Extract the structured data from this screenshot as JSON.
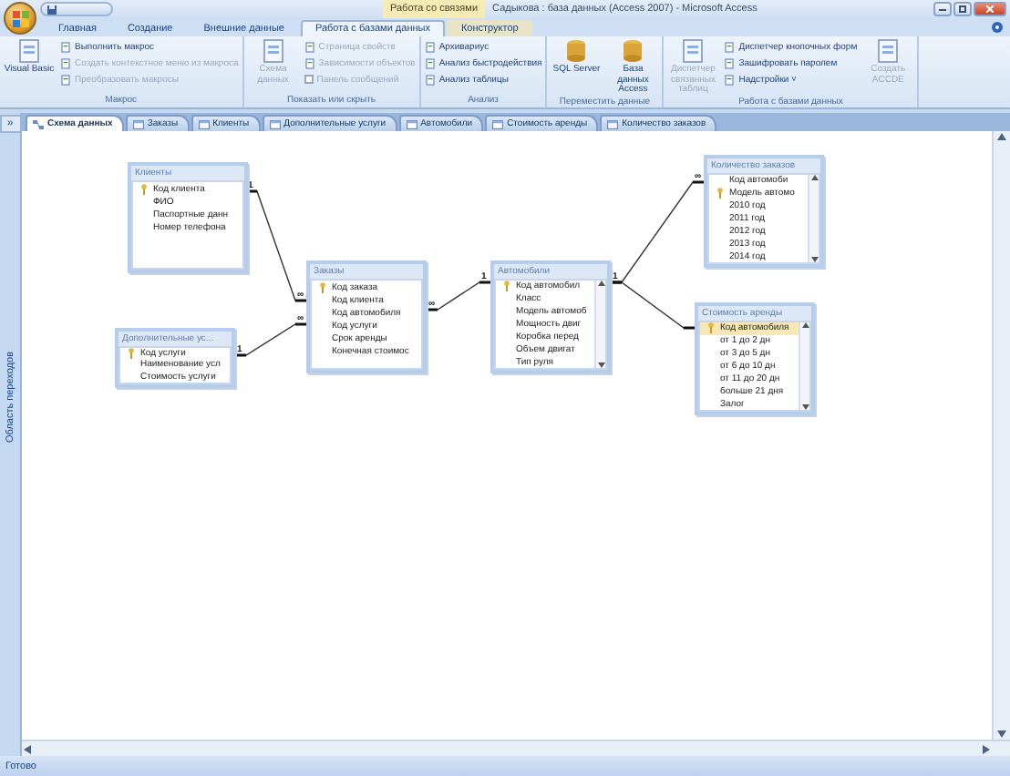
{
  "window": {
    "context_tab": "Работа со связями",
    "title": "Садыкова : база данных (Access 2007) - Microsoft Access"
  },
  "ribbon_tabs": [
    {
      "label": "Главная",
      "selected": false,
      "context": false
    },
    {
      "label": "Создание",
      "selected": false,
      "context": false
    },
    {
      "label": "Внешние данные",
      "selected": false,
      "context": false
    },
    {
      "label": "Работа с базами данных",
      "selected": true,
      "context": false
    },
    {
      "label": "Конструктор",
      "selected": false,
      "context": true
    }
  ],
  "ribbon_groups": [
    {
      "title": "Макрос",
      "items": [
        {
          "kind": "large",
          "label": "Visual Basic",
          "disabled": false
        },
        {
          "kind": "stack",
          "items": [
            {
              "label": "Выполнить макрос",
              "disabled": false
            },
            {
              "label": "Создать контекстное меню из макроса",
              "disabled": true
            },
            {
              "label": "Преобразовать макросы",
              "disabled": true
            }
          ]
        }
      ]
    },
    {
      "title": "Показать или скрыть",
      "items": [
        {
          "kind": "large",
          "label": "Схема данных",
          "disabled": true
        },
        {
          "kind": "stack",
          "items": [
            {
              "label": "Страница свойств",
              "disabled": true
            },
            {
              "label": "Зависимости объектов",
              "disabled": true
            },
            {
              "label": "Панель сообщений",
              "disabled": true,
              "checkbox": true,
              "checked": false
            }
          ]
        }
      ]
    },
    {
      "title": "Анализ",
      "items": [
        {
          "kind": "stack",
          "items": [
            {
              "label": "Архивариус",
              "disabled": false
            },
            {
              "label": "Анализ быстродействия",
              "disabled": false
            },
            {
              "label": "Анализ таблицы",
              "disabled": false
            }
          ]
        }
      ]
    },
    {
      "title": "Переместить данные",
      "items": [
        {
          "kind": "database",
          "label": "SQL Server",
          "disabled": false
        },
        {
          "kind": "database",
          "label": "База данных Access",
          "disabled": false
        }
      ]
    },
    {
      "title": "Работа с базами данных",
      "items": [
        {
          "kind": "large",
          "label": "Диспетчер связанных таблиц",
          "disabled": true
        },
        {
          "kind": "stack",
          "items": [
            {
              "label": "Диспетчер кнопочных форм",
              "disabled": false
            },
            {
              "label": "Зашифровать паролем",
              "disabled": false
            },
            {
              "label": "Надстройки ˅",
              "disabled": false
            }
          ]
        },
        {
          "kind": "large",
          "label": "Создать ACCDE",
          "disabled": true
        }
      ]
    }
  ],
  "nav_pane": {
    "toggle": "»",
    "label": "Область переходов"
  },
  "doc_tabs": [
    {
      "label": "Схема данных",
      "selected": true,
      "kind": "diagram"
    },
    {
      "label": "Заказы",
      "selected": false,
      "kind": "table"
    },
    {
      "label": "Клиенты",
      "selected": false,
      "kind": "table"
    },
    {
      "label": "Дополнительные услуги",
      "selected": false,
      "kind": "table"
    },
    {
      "label": "Автомобили",
      "selected": false,
      "kind": "table"
    },
    {
      "label": "Стоимость аренды",
      "selected": false,
      "kind": "table"
    },
    {
      "label": "Количество заказов",
      "selected": false,
      "kind": "table"
    }
  ],
  "tables": [
    {
      "title": "Клиенты",
      "scrollable": false,
      "fields": [
        {
          "name": "Код клиента",
          "key": true,
          "selected": false
        },
        {
          "name": "ФИО",
          "key": false,
          "selected": false
        },
        {
          "name": "Паспортные данн",
          "key": false,
          "selected": false
        },
        {
          "name": "Номер телефона",
          "key": false,
          "selected": false
        }
      ]
    },
    {
      "title": "Дополнительные ус...",
      "scrollable": false,
      "fields": [
        {
          "name": "Код услуги",
          "key": true,
          "selected": false
        },
        {
          "name": "Наименование усл",
          "key": false,
          "selected": false
        },
        {
          "name": "Стоимость услуги",
          "key": false,
          "selected": false
        }
      ]
    },
    {
      "title": "Заказы",
      "scrollable": false,
      "fields": [
        {
          "name": "Код заказа",
          "key": true,
          "selected": false
        },
        {
          "name": "Код клиента",
          "key": false,
          "selected": false
        },
        {
          "name": "Код автомобиля",
          "key": false,
          "selected": false
        },
        {
          "name": "Код услуги",
          "key": false,
          "selected": false
        },
        {
          "name": "Срок аренды",
          "key": false,
          "selected": false
        },
        {
          "name": "Конечная стоимос",
          "key": false,
          "selected": false
        }
      ]
    },
    {
      "title": "Автомобили",
      "scrollable": true,
      "fields": [
        {
          "name": "Код автомобил",
          "key": true,
          "selected": false
        },
        {
          "name": "Класс",
          "key": false,
          "selected": false
        },
        {
          "name": "Модель автомоб",
          "key": false,
          "selected": false
        },
        {
          "name": "Мощность двиг",
          "key": false,
          "selected": false
        },
        {
          "name": "Коробка перед",
          "key": false,
          "selected": false
        },
        {
          "name": "Объем двигат",
          "key": false,
          "selected": false
        },
        {
          "name": "Тип руля",
          "key": false,
          "selected": false
        }
      ]
    },
    {
      "title": "Количество заказов",
      "scrollable": true,
      "fields": [
        {
          "name": "Код автомоби",
          "key": false,
          "selected": false
        },
        {
          "name": "Модель автомо",
          "key": true,
          "selected": false
        },
        {
          "name": "2010 год",
          "key": false,
          "selected": false
        },
        {
          "name": "2011 год",
          "key": false,
          "selected": false
        },
        {
          "name": "2012 год",
          "key": false,
          "selected": false
        },
        {
          "name": "2013 год",
          "key": false,
          "selected": false
        },
        {
          "name": "2014 год",
          "key": false,
          "selected": false
        }
      ]
    },
    {
      "title": "Стоимость аренды",
      "scrollable": true,
      "fields": [
        {
          "name": "Код автомобиля",
          "key": true,
          "selected": true
        },
        {
          "name": "от 1 до 2 дн",
          "key": false,
          "selected": false
        },
        {
          "name": "от 3 до 5 дн",
          "key": false,
          "selected": false
        },
        {
          "name": "от 6 до 10 дн",
          "key": false,
          "selected": false
        },
        {
          "name": "от 11 до 20 дн",
          "key": false,
          "selected": false
        },
        {
          "name": "больше 21 дня",
          "key": false,
          "selected": false
        },
        {
          "name": "Залог",
          "key": false,
          "selected": false
        }
      ]
    }
  ],
  "relationships": [
    {
      "kind": "join",
      "from_mark": "1",
      "to_mark": "∞"
    },
    {
      "kind": "join",
      "from_mark": "1",
      "to_mark": "∞"
    },
    {
      "kind": "join",
      "from_mark": "∞",
      "to_mark": "1"
    },
    {
      "kind": "join",
      "from_mark": "1",
      "to_mark": "∞"
    },
    {
      "kind": "join"
    }
  ],
  "status_bar": {
    "text": "Готово"
  }
}
